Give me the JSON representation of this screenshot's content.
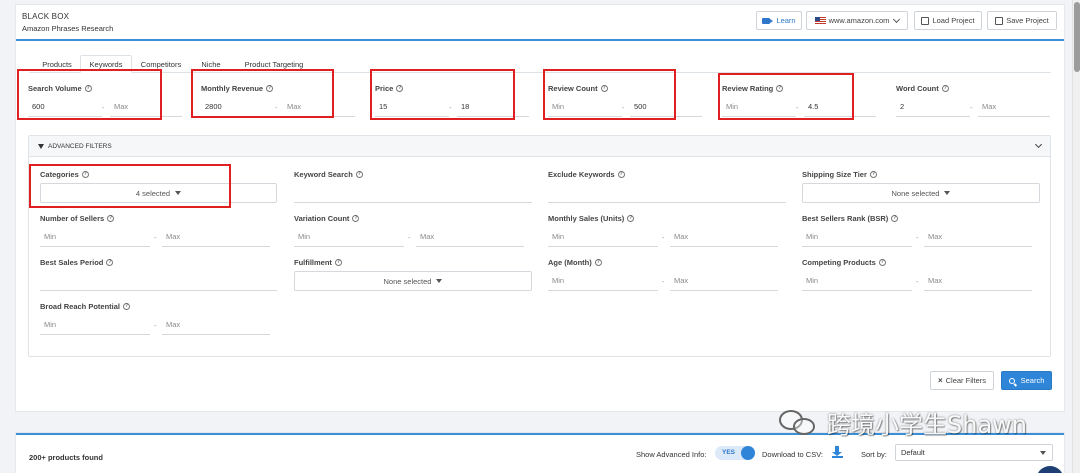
{
  "brand": {
    "name": "BLACK BOX",
    "subtitle": "Amazon Phrases Research"
  },
  "header": {
    "learn_label": "Learn",
    "marketplace": "www.amazon.com",
    "load_label": "Load Project",
    "save_label": "Save Project"
  },
  "tabs": [
    {
      "label": "Products",
      "active": false
    },
    {
      "label": "Keywords",
      "active": true
    },
    {
      "label": "Competitors",
      "active": false
    },
    {
      "label": "Niche",
      "active": false
    },
    {
      "label": "Product Targeting",
      "active": false
    }
  ],
  "filters": [
    {
      "label": "Search Volume",
      "min": "600",
      "max": "",
      "min_placeholder": "Min",
      "max_placeholder": "Max",
      "highlighted": true
    },
    {
      "label": "Monthly Revenue",
      "min": "2800",
      "max": "",
      "min_placeholder": "Min",
      "max_placeholder": "Max",
      "highlighted": true
    },
    {
      "label": "Price",
      "min": "15",
      "max": "18",
      "min_placeholder": "Min",
      "max_placeholder": "Max",
      "highlighted": true
    },
    {
      "label": "Review Count",
      "min": "",
      "max": "500",
      "min_placeholder": "Min",
      "max_placeholder": "Max",
      "highlighted": true
    },
    {
      "label": "Review Rating",
      "min": "",
      "max": "4.5",
      "min_placeholder": "Min",
      "max_placeholder": "Max",
      "highlighted": true
    },
    {
      "label": "Word Count",
      "min": "2",
      "max": "",
      "min_placeholder": "Min",
      "max_placeholder": "Max",
      "highlighted": false
    }
  ],
  "advanced": {
    "title": "ADVANCED FILTERS",
    "categories": {
      "label": "Categories",
      "value": "4 selected"
    },
    "keyword_search": {
      "label": "Keyword Search",
      "value": ""
    },
    "exclude_keywords": {
      "label": "Exclude Keywords",
      "value": ""
    },
    "shipping_size_tier": {
      "label": "Shipping Size Tier",
      "value": "None selected"
    },
    "number_of_sellers": {
      "label": "Number of Sellers",
      "min_placeholder": "Min",
      "max_placeholder": "Max"
    },
    "variation_count": {
      "label": "Variation Count",
      "min_placeholder": "Min",
      "max_placeholder": "Max"
    },
    "monthly_sales": {
      "label": "Monthly Sales (Units)",
      "min_placeholder": "Min",
      "max_placeholder": "Max"
    },
    "best_sellers_rank": {
      "label": "Best Sellers Rank (BSR)",
      "min_placeholder": "Min",
      "max_placeholder": "Max"
    },
    "best_sales_period": {
      "label": "Best Sales Period",
      "value": ""
    },
    "fulfillment": {
      "label": "Fulfillment",
      "value": "None selected"
    },
    "age_month": {
      "label": "Age (Month)",
      "min_placeholder": "Min",
      "max_placeholder": "Max"
    },
    "competing_products": {
      "label": "Competing Products",
      "min_placeholder": "Min",
      "max_placeholder": "Max"
    },
    "broad_reach_potential": {
      "label": "Broad Reach Potential",
      "min_placeholder": "Min",
      "max_placeholder": "Max"
    }
  },
  "actions": {
    "clear_label": "Clear Filters",
    "search_label": "Search"
  },
  "results": {
    "count_text": "200+ products found",
    "advanced_info_label": "Show Advanced Info:",
    "advanced_info_toggle": "YES",
    "download_label": "Download to CSV:",
    "sort_label": "Sort by:",
    "sort_value": "Default"
  },
  "watermark": {
    "text": "跨境小学生Shawn"
  },
  "colors": {
    "accent": "#2f86d9",
    "highlight_box": "#e02020",
    "top_rule": "#3a8fd6"
  }
}
